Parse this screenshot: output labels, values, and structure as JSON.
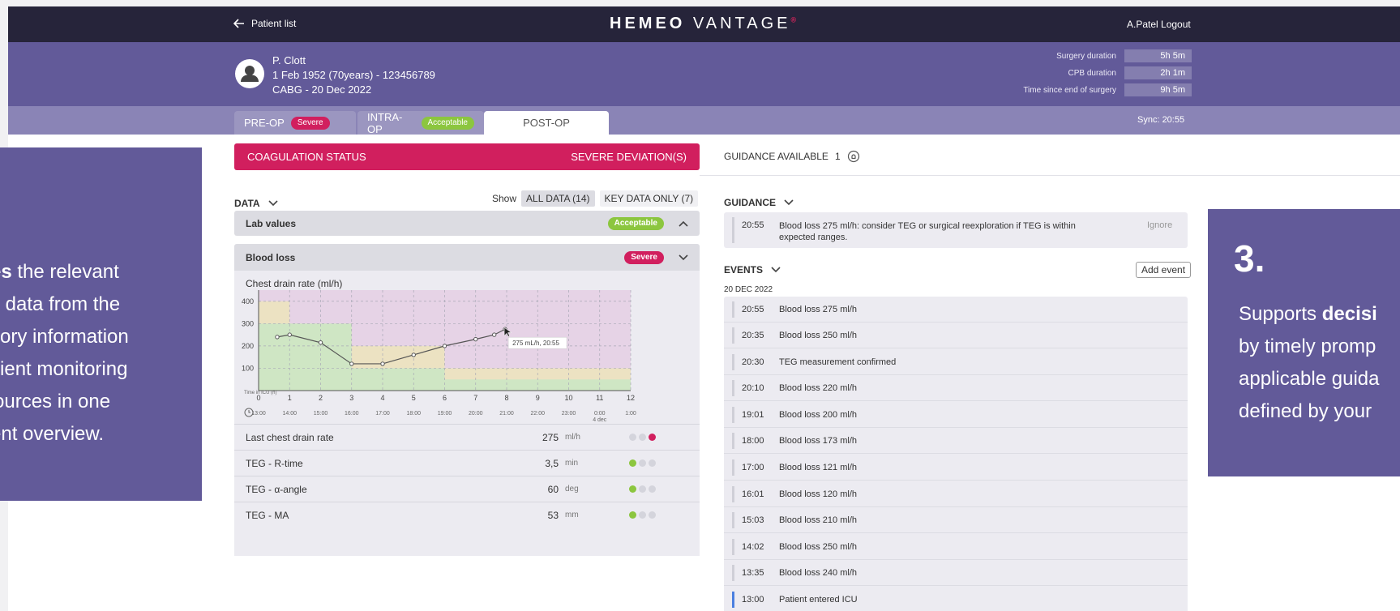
{
  "topbar": {
    "back_label": "Patient list",
    "brand_bold": "HEMEO",
    "brand_light": "VANTAGE",
    "brand_mark": "®",
    "user": "A.Patel Logout"
  },
  "patient": {
    "name": "P. Clott",
    "dob_line": "1 Feb 1952 (70years) - 123456789",
    "procedure": "CABG - 20 Dec 2022"
  },
  "durations": [
    {
      "label": "Surgery duration",
      "value": "5h 5m"
    },
    {
      "label": "CPB duration",
      "value": "2h 1m"
    },
    {
      "label": "Time since end of surgery",
      "value": "9h 5m"
    }
  ],
  "tabs": [
    {
      "label": "PRE-OP",
      "badge": "Severe"
    },
    {
      "label": "INTRA-OP",
      "badge": "Acceptable"
    },
    {
      "label": "POST-OP"
    }
  ],
  "sync": "Sync:  20:55",
  "coag": {
    "label": "COAGULATION STATUS",
    "status": "SEVERE DEVIATION(S)"
  },
  "data": {
    "header": "DATA",
    "show_label": "Show",
    "all_data": "ALL DATA (14)",
    "key_data": "KEY DATA ONLY (7)"
  },
  "sections": {
    "lab": {
      "label": "Lab values",
      "badge": "Acceptable"
    },
    "blood": {
      "label": "Blood loss",
      "badge": "Severe"
    }
  },
  "chart_data": {
    "type": "line",
    "title": "Chest drain rate (ml/h)",
    "x": [
      0.6,
      1,
      2,
      3,
      4,
      5,
      6,
      7,
      7.6,
      7.95
    ],
    "values": [
      240,
      250,
      215,
      120,
      120,
      160,
      200,
      230,
      250,
      275
    ],
    "xlim": [
      0,
      12
    ],
    "ylim": [
      0,
      450
    ],
    "yticks": [
      100,
      200,
      300,
      400
    ],
    "xticks": [
      "0",
      "1",
      "2",
      "3",
      "4",
      "5",
      "6",
      "7",
      "8",
      "9",
      "10",
      "11",
      "12"
    ],
    "time_labels": [
      "13:00",
      "14:00",
      "15:00",
      "16:00",
      "17:00",
      "18:00",
      "19:00",
      "20:00",
      "21:00",
      "22:00",
      "23:00",
      "0:00",
      "1:00"
    ],
    "time_sub": "4 dec",
    "time_axis_label": "Time in ICU (h)",
    "tooltip": "275 mL/h, 20:55",
    "zones": {
      "green": "#cfe6c4",
      "yellow": "#ece2c2",
      "purple": "#e6d3e6"
    },
    "line_color": "#555555",
    "grid": true
  },
  "values": [
    {
      "label": "Last chest drain rate",
      "value": "275",
      "unit": "ml/h",
      "status": 3
    },
    {
      "label": "TEG - R-time",
      "value": "3,5",
      "unit": "min",
      "status": 1
    },
    {
      "label": "TEG - α-angle",
      "value": "60",
      "unit": "deg",
      "status": 1
    },
    {
      "label": "TEG - MA",
      "value": "53",
      "unit": "mm",
      "status": 1
    }
  ],
  "guidance": {
    "available_label": "GUIDANCE AVAILABLE",
    "available_count": "1",
    "header": "GUIDANCE",
    "items": [
      {
        "time": "20:55",
        "text": "Blood loss 275 ml/h: consider TEG or surgical reexploration if TEG is within expected ranges.",
        "action": "Ignore"
      }
    ]
  },
  "events": {
    "header": "EVENTS",
    "add_label": "Add event",
    "date": "20 DEC 2022",
    "items": [
      {
        "time": "20:55",
        "text": "Blood loss 275 ml/h"
      },
      {
        "time": "20:35",
        "text": "Blood loss 250 ml/h"
      },
      {
        "time": "20:30",
        "text": "TEG measurement confirmed"
      },
      {
        "time": "20:10",
        "text": "Blood loss 220 ml/h"
      },
      {
        "time": "19:01",
        "text": "Blood loss 200 ml/h"
      },
      {
        "time": "18:00",
        "text": "Blood loss 173 ml/h"
      },
      {
        "time": "17:00",
        "text": "Blood loss 121 ml/h"
      },
      {
        "time": "16:01",
        "text": "Blood loss 120 ml/h"
      },
      {
        "time": "15:03",
        "text": "Blood loss 210 ml/h"
      },
      {
        "time": "14:02",
        "text": "Blood loss 250 ml/h"
      },
      {
        "time": "13:35",
        "text": "Blood loss 240 ml/h"
      },
      {
        "time": "13:00",
        "text": "Patient entered ICU"
      }
    ]
  },
  "overlay_left": {
    "line1_bold": "tes",
    "line1_rest": " the relevant",
    "line2": "te data from the",
    "line3": "atory information",
    "line4": "atient monitoring",
    "line5": "sources in one",
    "line6": "rent overview."
  },
  "overlay_right": {
    "number": "3.",
    "line1_plain": "Supports ",
    "line1_bold": "decisi",
    "line2": "by timely promp",
    "line3": "applicable guida",
    "line4": "defined by your"
  }
}
